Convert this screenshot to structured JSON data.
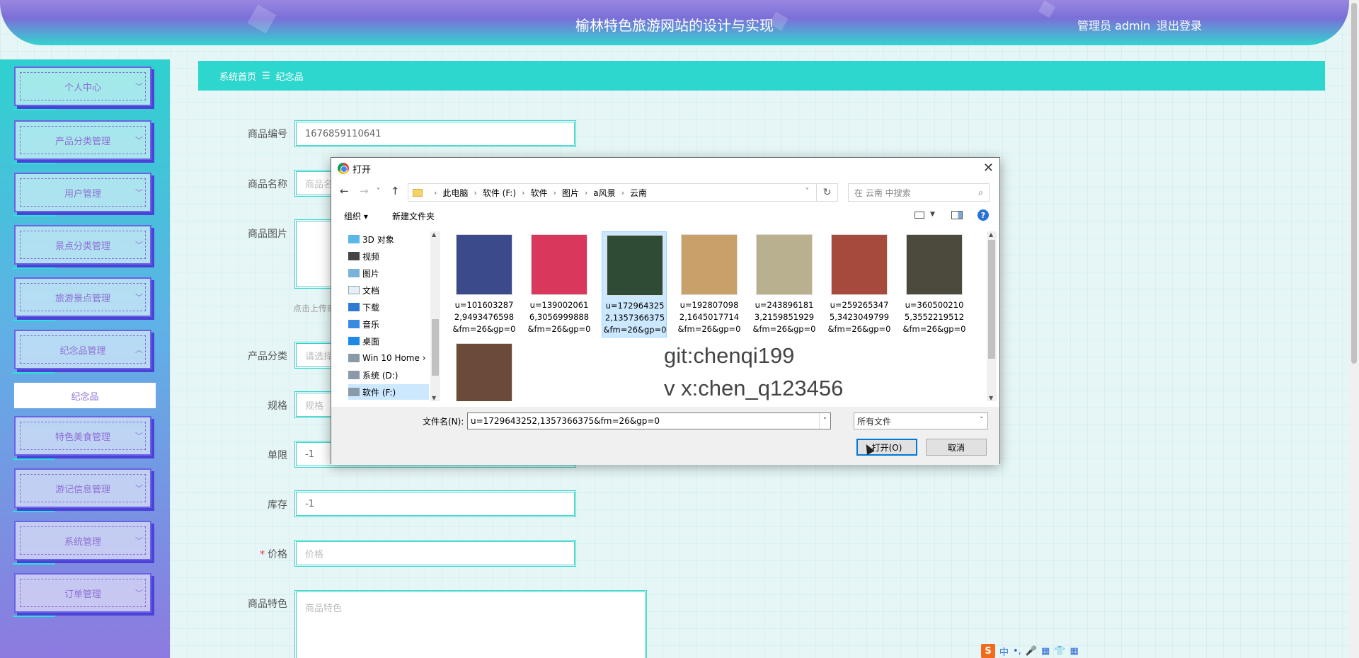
{
  "header": {
    "title": "榆林特色旅游网站的设计与实现",
    "user": "管理员 admin",
    "logout": "退出登录"
  },
  "sidebar": {
    "items": [
      {
        "label": "个人中心"
      },
      {
        "label": "产品分类管理"
      },
      {
        "label": "用户管理"
      },
      {
        "label": "景点分类管理"
      },
      {
        "label": "旅游景点管理"
      },
      {
        "label": "纪念品管理"
      },
      {
        "label": "特色美食管理"
      },
      {
        "label": "游记信息管理"
      },
      {
        "label": "系统管理"
      },
      {
        "label": "订单管理"
      }
    ],
    "submenu_active": "纪念品"
  },
  "breadcrumb": {
    "home": "系统首页",
    "separator": "☰",
    "current": "纪念品"
  },
  "form": {
    "code_label": "商品编号",
    "code_value": "1676859110641",
    "name_label": "商品名称",
    "name_placeholder": "商品名",
    "image_label": "商品图片",
    "upload_hint": "点击上传商",
    "category_label": "产品分类",
    "category_placeholder": "请选择",
    "spec_label": "规格",
    "spec_placeholder": "规格",
    "limit_label": "单限",
    "limit_value": "-1",
    "stock_label": "库存",
    "stock_value": "-1",
    "price_required": "*",
    "price_label": "价格",
    "price_placeholder": "价格",
    "feature_label": "商品特色",
    "feature_placeholder": "商品特色"
  },
  "dialog": {
    "title": "打开",
    "close": "✕",
    "path": [
      "此电脑",
      "软件 (F:)",
      "软件",
      "图片",
      "a风景",
      "云南"
    ],
    "search_placeholder": "在 云南 中搜索",
    "organize": "组织 ▾",
    "new_folder": "新建文件夹",
    "help": "?",
    "tree": [
      {
        "label": "3D 对象",
        "icon": "cube-icon"
      },
      {
        "label": "视频",
        "icon": "video-icon"
      },
      {
        "label": "图片",
        "icon": "picture-icon"
      },
      {
        "label": "文档",
        "icon": "document-icon"
      },
      {
        "label": "下载",
        "icon": "download-icon"
      },
      {
        "label": "音乐",
        "icon": "music-icon"
      },
      {
        "label": "桌面",
        "icon": "desktop-icon"
      },
      {
        "label": "Win 10 Home ›",
        "icon": "drive-icon"
      },
      {
        "label": "系统 (D:)",
        "icon": "drive-icon"
      },
      {
        "label": "软件 (F:)",
        "icon": "drive-icon"
      }
    ],
    "files": [
      {
        "name": "u=1016032872,9493476598&fm=26&gp=0",
        "color": "#3b4a8a"
      },
      {
        "name": "u=1390020616,3056999888&fm=26&gp=0",
        "color": "#d9375b"
      },
      {
        "name": "u=1729643252,1357366375&fm=26&gp=0",
        "color": "#2f4a35"
      },
      {
        "name": "u=1928070982,1645017714&fm=26&gp=0",
        "color": "#c9a06a"
      },
      {
        "name": "u=2438961813,2159851929&fm=26&gp=0",
        "color": "#b9b08f"
      },
      {
        "name": "u=2592653475,3423049799&fm=26&gp=0",
        "color": "#a54a3d"
      },
      {
        "name": "u=3605002105,3552219512&fm=26&gp=0",
        "color": "#4b4a3c"
      },
      {
        "name": "",
        "color": "#6b4a3a"
      }
    ],
    "watermark_line1": "git:chenqi199",
    "watermark_line2": "v x:chen_q123456",
    "filename_label": "文件名(N):",
    "filename_value": "u=1729643252,1357366375&fm=26&gp=0",
    "filetype": "所有文件",
    "open_button": "打开(O)",
    "cancel_button": "取消"
  },
  "ime": [
    "中",
    "•,",
    "🎤",
    "▦",
    "👕",
    "▦"
  ]
}
